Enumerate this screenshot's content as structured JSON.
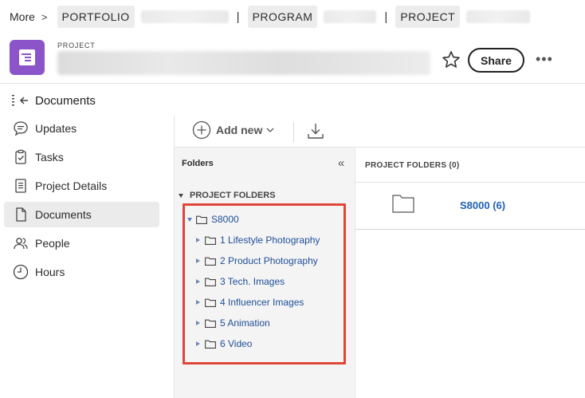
{
  "breadcrumb": {
    "more_label": "More",
    "sep": ">",
    "portfolio_label": "PORTFOLIO",
    "program_label": "PROGRAM",
    "project_label": "PROJECT",
    "bar": "|"
  },
  "header": {
    "label": "PROJECT",
    "share_label": "Share",
    "more_label": "•••"
  },
  "section": {
    "title": "Documents"
  },
  "nav": {
    "items": [
      {
        "label": "Updates",
        "icon": "chat-bubble-icon"
      },
      {
        "label": "Tasks",
        "icon": "clipboard-check-icon"
      },
      {
        "label": "Project Details",
        "icon": "document-lines-icon"
      },
      {
        "label": "Documents",
        "icon": "document-icon"
      },
      {
        "label": "People",
        "icon": "people-icon"
      },
      {
        "label": "Hours",
        "icon": "clock-icon"
      }
    ],
    "active": "Documents"
  },
  "toolbar": {
    "add_new_label": "Add new"
  },
  "folders_panel": {
    "title": "Folders",
    "collapse_glyph": "«",
    "root_section": "PROJECT FOLDERS",
    "root_folder": "S8000",
    "children": [
      "1 Lifestyle Photography",
      "2 Product Photography",
      "3 Tech. Images",
      "4 Influencer Images",
      "5 Animation",
      "6 Video"
    ]
  },
  "right_panel": {
    "header": "PROJECT FOLDERS (0)",
    "folder_link": "S8000 (6)"
  },
  "colors": {
    "accent_purple": "#8b55c9",
    "link_blue": "#1f5fb7",
    "highlight_red": "#e0473b"
  }
}
